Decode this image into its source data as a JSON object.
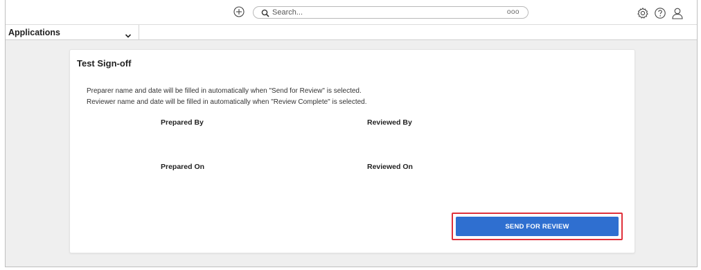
{
  "header": {
    "search": {
      "placeholder": "Search...",
      "more": "ooo"
    }
  },
  "subnav": {
    "applications_label": "Applications"
  },
  "card": {
    "title": "Test Sign-off",
    "instructions": [
      "Preparer name and date will be filled in automatically when \"Send for Review\" is selected.",
      "Reviewer name and date will be filled in automatically when \"Review Complete\" is selected."
    ],
    "fields": {
      "prepared_by": "Prepared By",
      "reviewed_by": "Reviewed By",
      "prepared_on": "Prepared On",
      "reviewed_on": "Reviewed On"
    },
    "send_button_label": "SEND FOR REVIEW"
  },
  "colors": {
    "primary_button": "#2f6fd0",
    "highlight_outline": "#e0303a",
    "page_background": "#efefef"
  },
  "icons": [
    "add-circle-icon",
    "search-icon",
    "gear-icon",
    "help-icon",
    "user-icon",
    "chevron-down-icon"
  ]
}
